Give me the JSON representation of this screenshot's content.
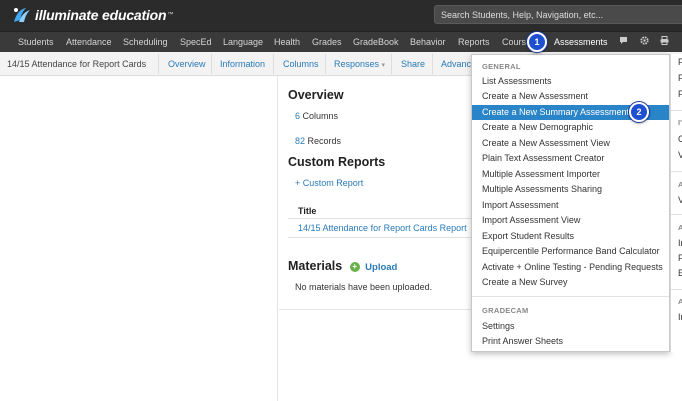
{
  "brand": {
    "name": "illuminate education",
    "tm": "™"
  },
  "search": {
    "placeholder": "Search Students, Help, Navigation, etc..."
  },
  "nav": {
    "items": [
      "Students",
      "Attendance",
      "Scheduling",
      "SpecEd",
      "Language",
      "Health",
      "Grades",
      "GradeBook",
      "Behavior",
      "Reports",
      "Cours",
      "Assessments"
    ],
    "icons": [
      "chat-icon",
      "gear-icon",
      "print-icon"
    ]
  },
  "subbar": {
    "title": "14/15 Attendance for Report Cards",
    "tabs": [
      "Overview",
      "Information",
      "Columns",
      "Responses",
      "Share",
      "Advanc"
    ],
    "responses_caret": "▾"
  },
  "overview": {
    "heading": "Overview",
    "columns_count": "6",
    "columns_label": "Columns",
    "records_count": "82",
    "records_label": "Records"
  },
  "custom_reports": {
    "heading": "Custom Reports",
    "add_link": "+ Custom Report",
    "table_header": "Title",
    "rows": [
      "14/15 Attendance for Report Cards Report"
    ]
  },
  "materials": {
    "heading": "Materials",
    "upload_label": "Upload",
    "empty_text": "No materials have been uploaded."
  },
  "dropdown": {
    "general_label": "GENERAL",
    "items": [
      "List Assessments",
      "Create a New Assessment",
      "Create a New Summary Assessment",
      "Create a New Demographic",
      "Create a New Assessment View",
      "Plain Text Assessment Creator",
      "Multiple Assessment Importer",
      "Multiple Assessments Sharing",
      "Import Assessment",
      "Import Assessment View",
      "Export Student Results",
      "Equipercentile Performance Band Calculator",
      "Activate + Online Testing - Pending Requests",
      "Create a New Survey"
    ],
    "highlighted_index": 2,
    "gradecam_label": "GRADECAM",
    "gradecam_items": [
      "Settings",
      "Print Answer Sheets"
    ]
  },
  "right_column": {
    "letters": [
      "F",
      "F",
      "F",
      "I'",
      "C",
      "V",
      "A",
      "V",
      "A",
      "Ir",
      "F",
      "E",
      "A",
      "Ir"
    ]
  },
  "callouts": [
    "1",
    "2"
  ],
  "colors": {
    "topbar": "#2b2b2b",
    "navbar": "#3a3a3a",
    "link": "#2a7ab8",
    "highlight": "#2a84c8",
    "callout": "#1d4fd0"
  }
}
